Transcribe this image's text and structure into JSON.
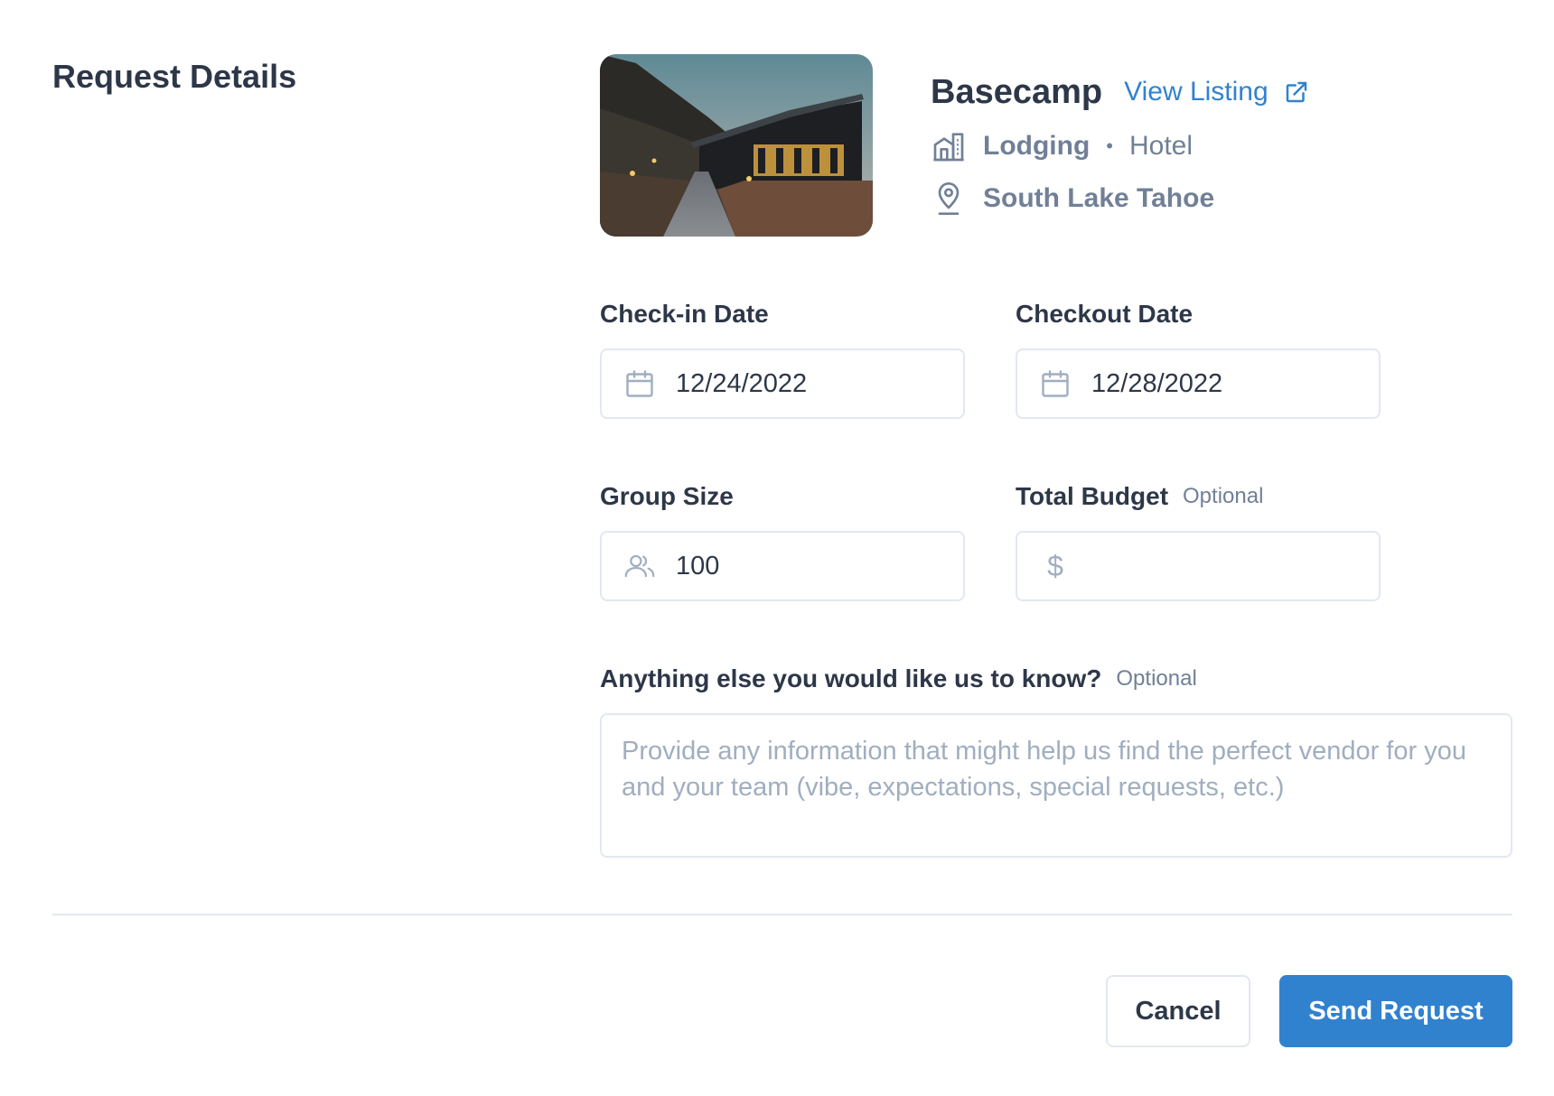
{
  "section": {
    "title": "Request Details"
  },
  "listing": {
    "name": "Basecamp",
    "view_listing_label": "View Listing",
    "category": "Lodging",
    "separator": "•",
    "type": "Hotel",
    "location": "South Lake Tahoe"
  },
  "form": {
    "checkin": {
      "label": "Check-in Date",
      "value": "12/24/2022"
    },
    "checkout": {
      "label": "Checkout Date",
      "value": "12/28/2022"
    },
    "group_size": {
      "label": "Group Size",
      "value": "100"
    },
    "budget": {
      "label": "Total Budget",
      "optional": "Optional",
      "currency_symbol": "$",
      "value": ""
    },
    "notes": {
      "label": "Anything else you would like us to know?",
      "optional": "Optional",
      "placeholder": "Provide any information that might help us find the perfect vendor for you and your team (vibe, expectations, special requests, etc.)",
      "value": ""
    }
  },
  "actions": {
    "cancel_label": "Cancel",
    "send_label": "Send Request"
  },
  "colors": {
    "accent": "#3182ce",
    "heading": "#2d3748",
    "muted": "#718096",
    "border": "#e2e8f0",
    "icon": "#a0aec0"
  },
  "icons": {
    "external_link": "external-link-icon",
    "building": "building-icon",
    "location": "map-pin-icon",
    "calendar": "calendar-icon",
    "users": "users-icon",
    "dollar": "dollar-icon"
  }
}
